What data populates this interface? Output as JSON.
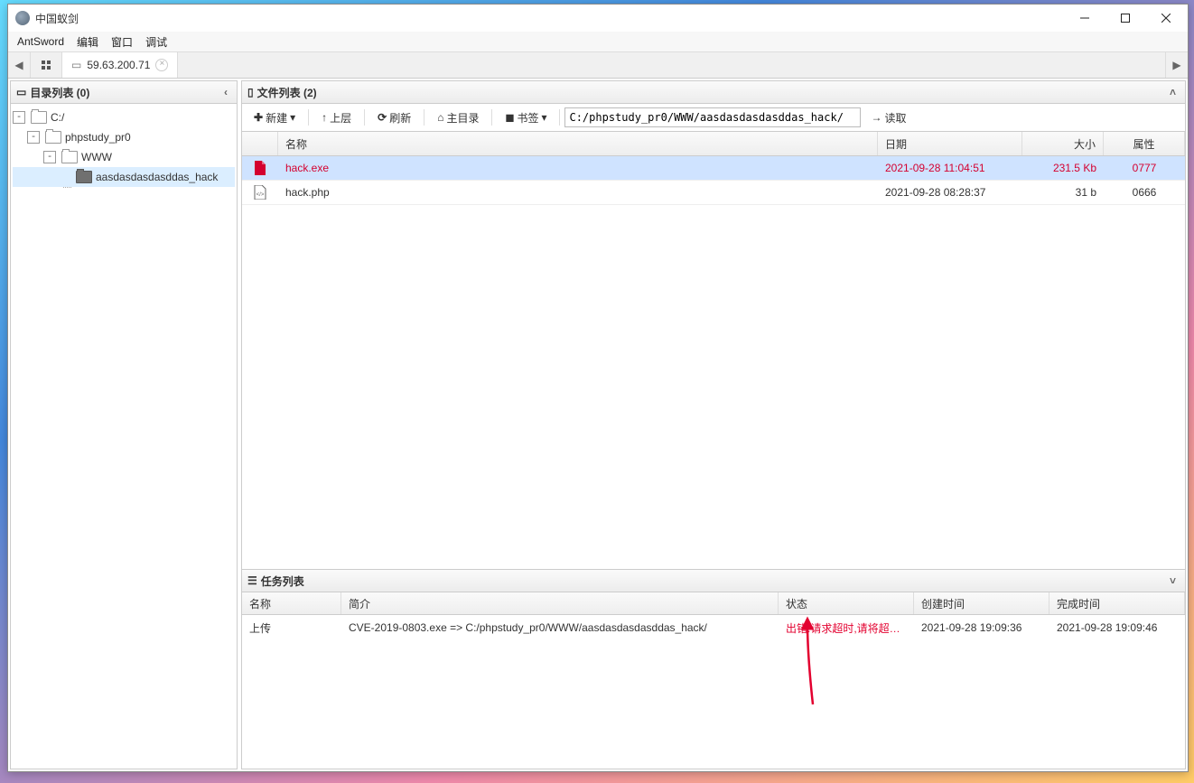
{
  "window": {
    "title": "中国蚁剑"
  },
  "menu": {
    "antsword": "AntSword",
    "edit": "编辑",
    "window": "窗口",
    "debug": "调试"
  },
  "tab": {
    "ip": "59.63.200.71"
  },
  "leftPanel": {
    "title": "目录列表 (0)"
  },
  "tree": {
    "n0": "C:/",
    "n1": "phpstudy_pr0",
    "n2": "WWW",
    "n3": "aasdasdasdasddas_hack"
  },
  "rightPanel": {
    "title": "文件列表 (2)"
  },
  "toolbar": {
    "new": "新建",
    "up": "上层",
    "refresh": "刷新",
    "home": "主目录",
    "bookmark": "书签",
    "read": "读取",
    "path": "C:/phpstudy_pr0/WWW/aasdasdasdasddas_hack/"
  },
  "cols": {
    "name": "名称",
    "date": "日期",
    "size": "大小",
    "attr": "属性"
  },
  "files": [
    {
      "name": "hack.exe",
      "date": "2021-09-28 11:04:51",
      "size": "231.5 Kb",
      "attr": "0777",
      "sel": true,
      "red": true
    },
    {
      "name": "hack.php",
      "date": "2021-09-28 08:28:37",
      "size": "31 b",
      "attr": "0666",
      "sel": false,
      "red": false
    }
  ],
  "taskPanel": {
    "title": "任务列表"
  },
  "taskCols": {
    "name": "名称",
    "desc": "简介",
    "status": "状态",
    "created": "创建时间",
    "finished": "完成时间"
  },
  "tasks": [
    {
      "name": "上传",
      "desc": "CVE-2019-0803.exe => C:/phpstudy_pr0/WWW/aasdasdasdasddas_hack/",
      "status": "出错:请求超时,请将超时时",
      "created": "2021-09-28 19:09:36",
      "finished": "2021-09-28 19:09:46"
    }
  ]
}
